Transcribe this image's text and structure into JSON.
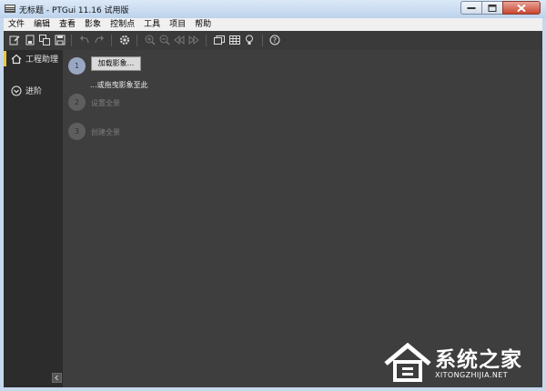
{
  "window": {
    "title": "无标题 - PTGui 11.16 试用版"
  },
  "menu": [
    "文件",
    "编辑",
    "查看",
    "影象",
    "控制点",
    "工具",
    "项目",
    "帮助"
  ],
  "toolbar_icons": [
    "new-project-icon",
    "open-project-icon",
    "copy-project-icon",
    "save-icon",
    "undo-icon",
    "redo-icon",
    "settings-gear-icon",
    "zoom-in-icon",
    "zoom-out-icon",
    "previous-icon",
    "next-icon",
    "panorama-editor-icon",
    "table-grid-icon",
    "light-bulb-icon",
    "help-icon"
  ],
  "sidebar": {
    "items": [
      {
        "label": "工程助理",
        "icon": "home-icon",
        "selected": true
      },
      {
        "label": "进阶",
        "icon": "chevron-down-circle-icon",
        "selected": false
      }
    ],
    "collapse_icon": "chevron-left-icon",
    "accent_color": "#e8c84a"
  },
  "steps": [
    {
      "number": "1",
      "button_label": "加载影象...",
      "hint": "...或拖曳影象至此",
      "active": true
    },
    {
      "number": "2",
      "label": "设置全景",
      "active": false
    },
    {
      "number": "3",
      "label": "创建全景",
      "active": false
    }
  ],
  "watermark": {
    "title": "系统之家",
    "subtitle": "XITONGZHIJIA.NET"
  }
}
